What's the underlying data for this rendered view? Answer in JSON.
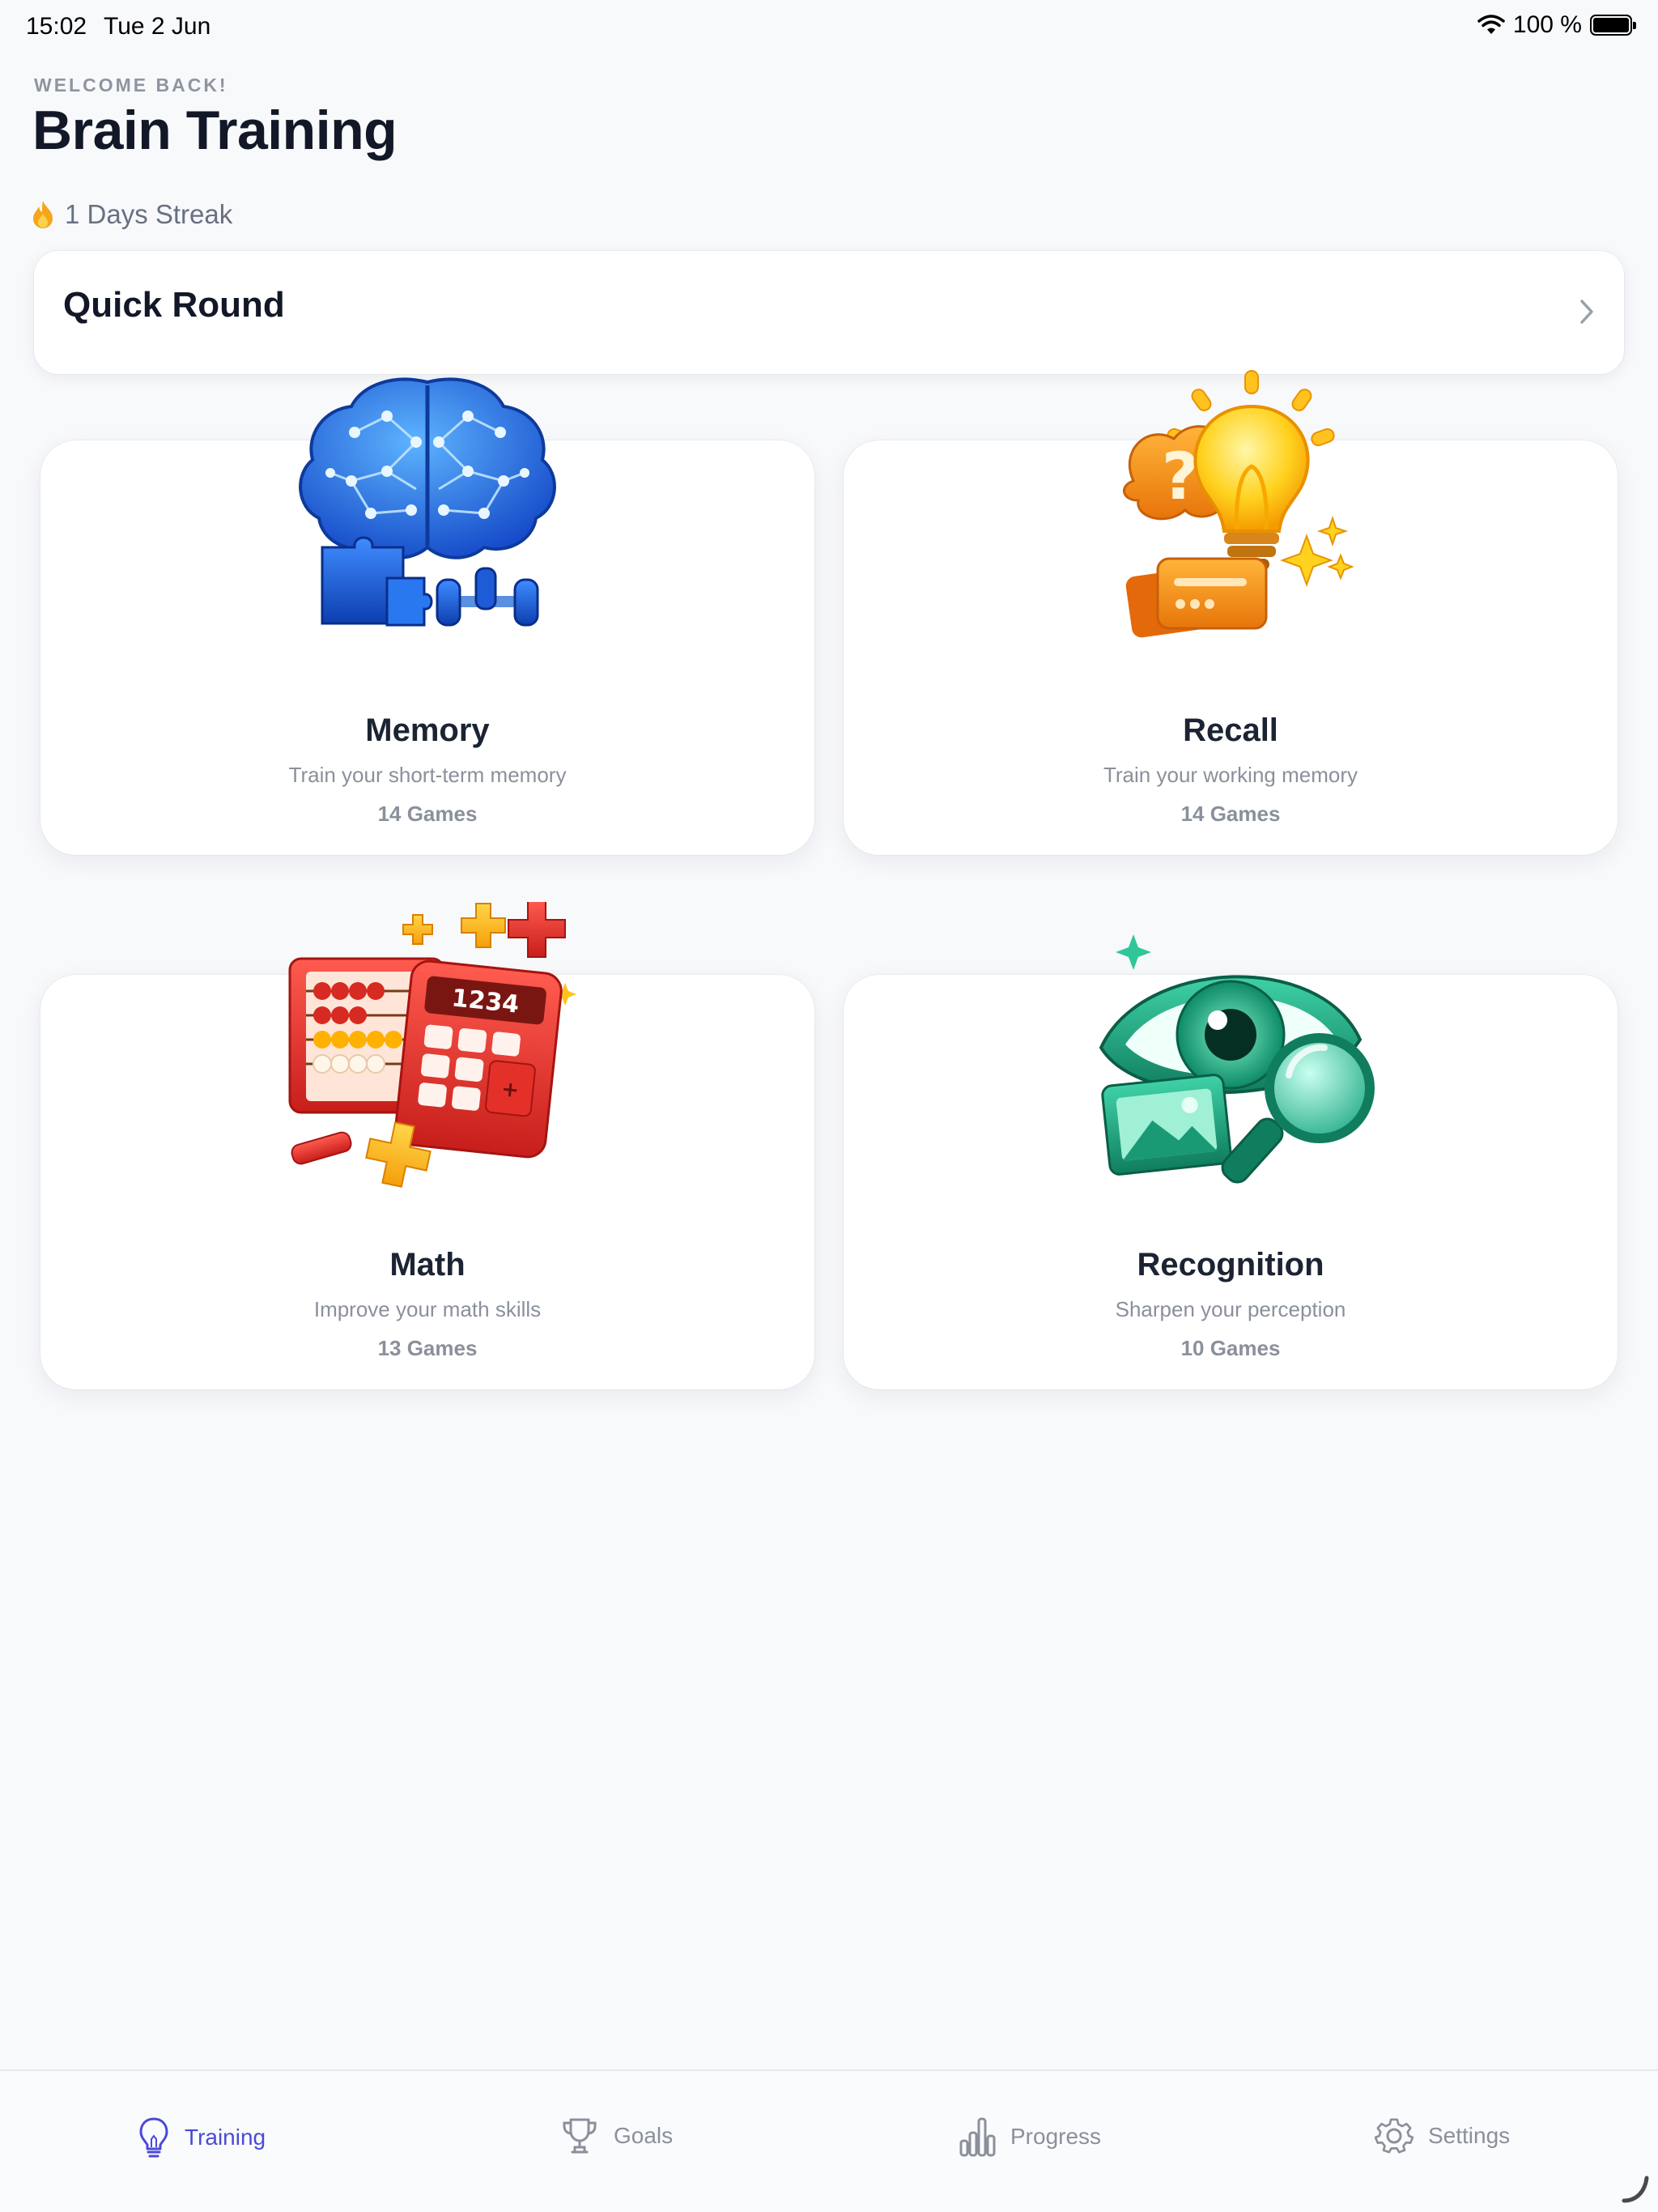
{
  "status_bar": {
    "time": "15:02",
    "date": "Tue 2 Jun",
    "battery": "100 %"
  },
  "header": {
    "welcome": "WELCOME BACK!",
    "title": "Brain Training",
    "streak": "1 Days Streak"
  },
  "quick_round": {
    "label": "Quick Round"
  },
  "categories": [
    {
      "name": "Memory",
      "description": "Train your short-term memory",
      "count": "14 Games",
      "icon": "brain-icon"
    },
    {
      "name": "Recall",
      "description": "Train your working memory",
      "count": "14 Games",
      "icon": "lightbulb-icon"
    },
    {
      "name": "Math",
      "description": "Improve your math skills",
      "count": "13 Games",
      "icon": "calculator-icon",
      "display": "1234"
    },
    {
      "name": "Recognition",
      "description": "Sharpen your perception",
      "count": "10 Games",
      "icon": "eye-icon"
    }
  ],
  "tabs": [
    {
      "label": "Training",
      "icon": "lightbulb-icon",
      "active": true
    },
    {
      "label": "Goals",
      "icon": "trophy-icon"
    },
    {
      "label": "Progress",
      "icon": "bar-chart-icon"
    },
    {
      "label": "Settings",
      "icon": "gear-icon"
    }
  ],
  "colors": {
    "accent": "#4a49d8",
    "memory": "#1f6ee8",
    "recall": "#f7a21b",
    "math": "#e3312a",
    "recognition": "#1aa37f"
  }
}
